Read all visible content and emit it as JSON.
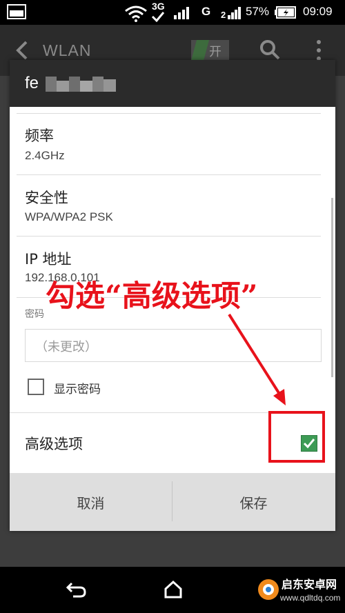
{
  "status_bar": {
    "network_3g": "3G",
    "network_g": "G",
    "battery_percent": "57%",
    "time": "09:09"
  },
  "action_bar": {
    "title": "WLAN",
    "toggle_label": "开"
  },
  "dialog": {
    "title": "fe",
    "frequency": {
      "label": "频率",
      "value": "2.4GHz"
    },
    "security": {
      "label": "安全性",
      "value": "WPA/WPA2 PSK"
    },
    "ip": {
      "label": "IP 地址",
      "value": "192.168.0.101"
    },
    "password": {
      "label": "密码",
      "placeholder": "（未更改）"
    },
    "show_password": "显示密码",
    "advanced": {
      "label": "高级选项",
      "checked": true
    },
    "buttons": {
      "cancel": "取消",
      "save": "保存"
    }
  },
  "annotation": {
    "text": "勾选“高级选项”",
    "color": "#e8121b"
  },
  "watermark": {
    "text": "启东安卓网",
    "url": "www.qdltdq.com"
  }
}
